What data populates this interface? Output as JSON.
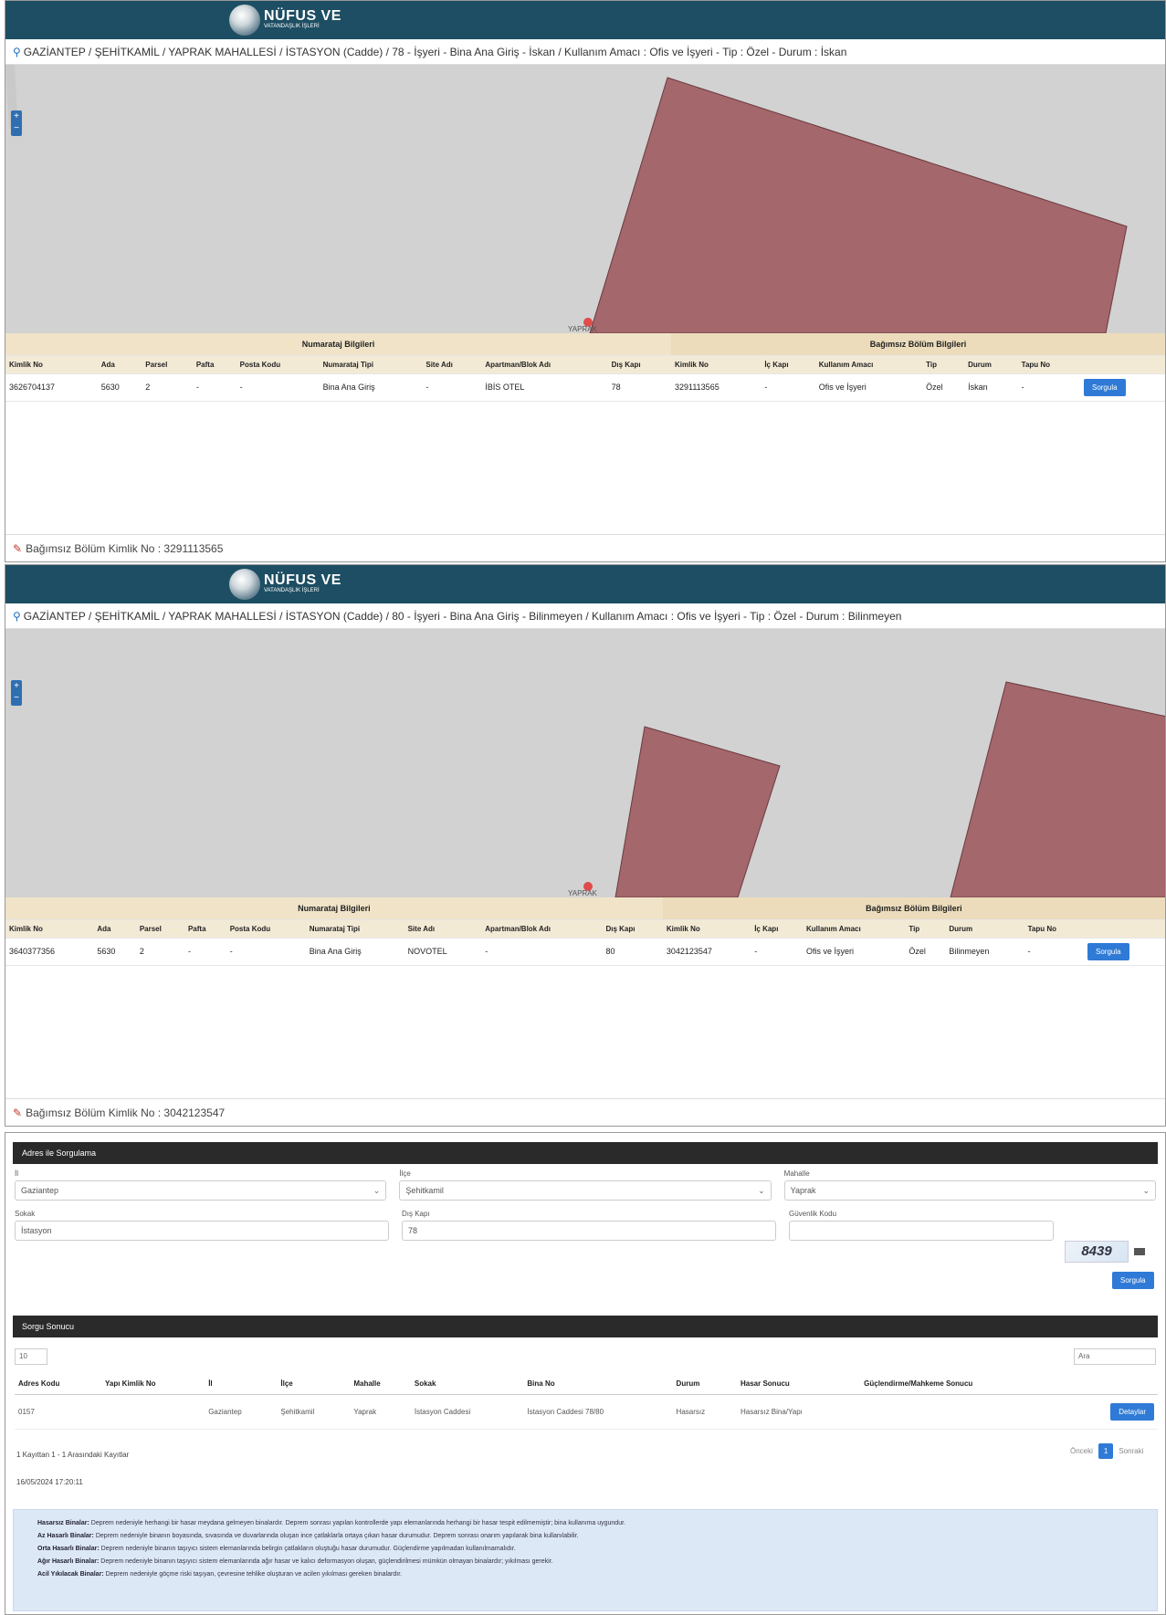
{
  "records": [
    {
      "logo": {
        "title": "NÜFUS VE",
        "subtitle": "VATANDAŞLIK İŞLERİ"
      },
      "address": "GAZİANTEP / ŞEHİTKAMİL / YAPRAK MAHALLESİ / İSTASYON (Cadde) / 78 - İşyeri - Bina Ana Giriş - İskan / Kullanım Amacı : Ofis ve İşyeri - Tip : Özel - Durum : İskan",
      "map_marker_label": "YAPRAK",
      "group_headers": {
        "numbering": "Numarataj Bilgileri",
        "independent": "Bağımsız Bölüm Bilgileri"
      },
      "columns": [
        "Kimlik No",
        "Ada",
        "Parsel",
        "Pafta",
        "Posta Kodu",
        "Numarataj Tipi",
        "Site Adı",
        "Apartman/Blok Adı",
        "Dış Kapı",
        "Kimlik No",
        "İç Kapı",
        "Kullanım Amacı",
        "Tip",
        "Durum",
        "Tapu No"
      ],
      "row": [
        "3626704137",
        "5630",
        "2",
        "-",
        "-",
        "Bina Ana Giriş",
        "-",
        "İBİS OTEL",
        "78",
        "3291113565",
        "-",
        "Ofis ve İşyeri",
        "Özel",
        "İskan",
        "-"
      ],
      "action_label": "Sorgula",
      "footer": "Bağımsız Bölüm Kimlik No : 3291113565"
    },
    {
      "logo": {
        "title": "NÜFUS VE",
        "subtitle": "VATANDAŞLIK İŞLERİ"
      },
      "address": "GAZİANTEP / ŞEHİTKAMİL / YAPRAK MAHALLESİ / İSTASYON (Cadde) / 80 - İşyeri - Bina Ana Giriş - Bilinmeyen / Kullanım Amacı : Ofis ve İşyeri - Tip : Özel - Durum : Bilinmeyen",
      "map_marker_label": "YAPRAK",
      "group_headers": {
        "numbering": "Numarataj Bilgileri",
        "independent": "Bağımsız Bölüm Bilgileri"
      },
      "columns": [
        "Kimlik No",
        "Ada",
        "Parsel",
        "Pafta",
        "Posta Kodu",
        "Numarataj Tipi",
        "Site Adı",
        "Apartman/Blok Adı",
        "Dış Kapı",
        "Kimlik No",
        "İç Kapı",
        "Kullanım Amacı",
        "Tip",
        "Durum",
        "Tapu No"
      ],
      "row": [
        "3640377356",
        "5630",
        "2",
        "-",
        "-",
        "Bina Ana Giriş",
        "NOVOTEL",
        "-",
        "80",
        "3042123547",
        "-",
        "Ofis ve İşyeri",
        "Özel",
        "Bilinmeyen",
        "-"
      ],
      "action_label": "Sorgula",
      "footer": "Bağımsız Bölüm Kimlik No : 3042123547"
    }
  ],
  "query_form": {
    "title": "Adres ile Sorgulama",
    "fields": [
      {
        "label": "İl",
        "value": "Gaziantep"
      },
      {
        "label": "İlçe",
        "value": "Şehitkamil"
      },
      {
        "label": "Mahalle",
        "value": "Yaprak"
      },
      {
        "label": "Sokak",
        "value": "İstasyon"
      },
      {
        "label": "Dış Kapı",
        "value": "78"
      },
      {
        "label": "Güvenlik Kodu",
        "value": ""
      }
    ],
    "captcha_text": "8439",
    "search_label": "Sorgula"
  },
  "results": {
    "title": "Sorgu Sonucu",
    "length_value": "10",
    "filter_placeholder": "Ara",
    "columns": [
      "Adres Kodu",
      "Yapı Kimlik No",
      "İl",
      "İlçe",
      "Mahalle",
      "Sokak",
      "Bina No",
      "Durum",
      "Hasar Sonucu",
      "Güçlendirme/Mahkeme Sonucu"
    ],
    "rows": [
      [
        "0157",
        "",
        "Gaziantep",
        "Şehitkamil",
        "Yaprak",
        "İstasyon Caddesi",
        "İstasyon Caddesi 78/80",
        "Hasarsız",
        "Hasarsız Bina/Yapı",
        ""
      ]
    ],
    "row_action": "Detaylar",
    "info": "1 Kayıttan 1 - 1 Arasındaki Kayıtlar",
    "timestamp": "16/05/2024 17:20:11",
    "pager": {
      "prev": "Önceki",
      "page": "1",
      "next": "Sonraki"
    }
  },
  "legend": [
    {
      "term": "Hasarsız Binalar:",
      "text": "Deprem nedeniyle herhangi bir hasar meydana gelmeyen binalardır. Deprem sonrası yapılan kontrollerde yapı elemanlarında herhangi bir hasar tespit edilmemiştir; bina kullanıma uygundur."
    },
    {
      "term": "Az Hasarlı Binalar:",
      "text": "Deprem nedeniyle binanın boyasında, sıvasında ve duvarlarında oluşan ince çatlaklarla ortaya çıkan hasar durumudur. Deprem sonrası onarım yapılarak bina kullanılabilir."
    },
    {
      "term": "Orta Hasarlı Binalar:",
      "text": "Deprem nedeniyle binanın taşıyıcı sistem elemanlarında belirgin çatlakların oluştuğu hasar durumudur. Güçlendirme yapılmadan kullanılmamalıdır."
    },
    {
      "term": "Ağır Hasarlı Binalar:",
      "text": "Deprem nedeniyle binanın taşıyıcı sistem elemanlarında ağır hasar ve kalıcı deformasyon oluşan, güçlendirilmesi mümkün olmayan binalardır; yıkılması gerekir."
    },
    {
      "term": "Acil Yıkılacak Binalar:",
      "text": "Deprem nedeniyle göçme riski taşıyan, çevresine tehlike oluşturan ve acilen yıkılması gereken binalardır."
    }
  ]
}
